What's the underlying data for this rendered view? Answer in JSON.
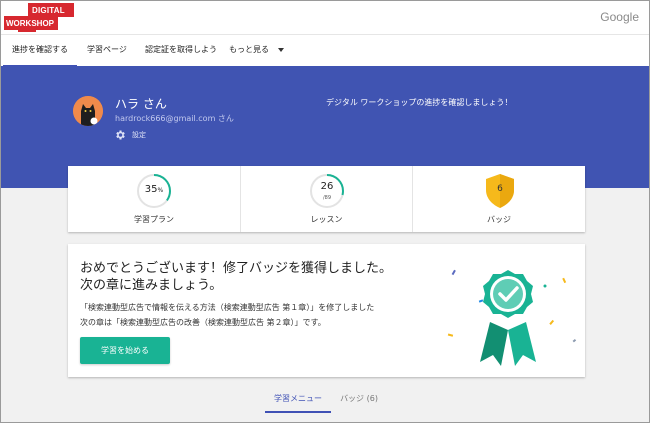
{
  "brand": {
    "logo_line1": "DIGITAL",
    "logo_line2": "WORKSHOP",
    "google": "Google"
  },
  "nav": [
    {
      "label": "進捗を確認する"
    },
    {
      "label": "学習ページ"
    },
    {
      "label": "認定証を取得しよう"
    },
    {
      "label": "もっと見る"
    }
  ],
  "profile": {
    "name": "ハラ さん",
    "email": "hardrock666@gmail.com さん",
    "settings_label": "設定",
    "message": "デジタル ワークショップの進捗を確認しましょう！"
  },
  "stats": [
    {
      "label": "学習プラン",
      "value": "35",
      "unit": "%",
      "progress": 0.35
    },
    {
      "label": "レッスン",
      "value": "26",
      "sub": "/89",
      "progress": 0.29
    },
    {
      "label": "バッジ",
      "value": "6"
    }
  ],
  "card": {
    "title_line1": "おめでとうございます！修了バッジを獲得しました。",
    "title_line2": "次の章に進みましょう。",
    "body_line1": "「検索連動型広告で情報を伝える方法（検索連動型広告 第１章）」を修了しました",
    "body_line2": "次の章は「検索連動型広告の改善（検索連動型広告 第２章）」です。",
    "button": "学習を始める"
  },
  "tabs": [
    {
      "label": "学習メニュー"
    },
    {
      "label": "バッジ (6)"
    }
  ],
  "colors": {
    "hero": "#4054b2",
    "accent_teal": "#19b394",
    "badge_gold": "#f6b91b",
    "logo_red": "#d7282f",
    "tab_blue": "#3f51b5"
  }
}
